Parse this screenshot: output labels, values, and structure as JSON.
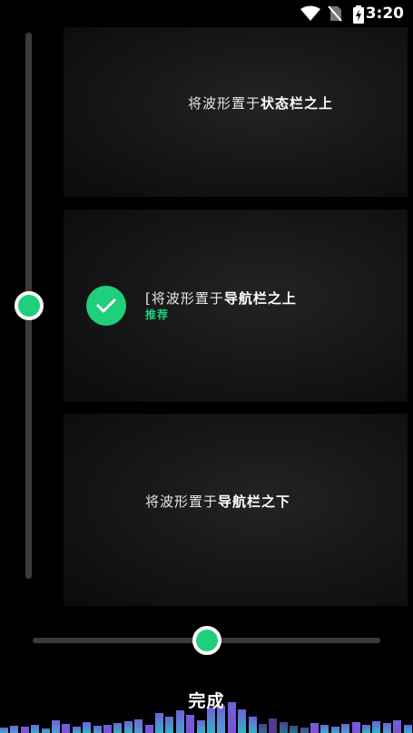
{
  "status_bar": {
    "time": "3:20",
    "icons": [
      "wifi-icon",
      "no-sim-icon",
      "battery-charging-icon"
    ]
  },
  "vertical_slider": {
    "level": 0.5
  },
  "horizontal_slider": {
    "level": 0.5
  },
  "options": [
    {
      "text_plain": "将波形置于",
      "text_bold": "状态栏之上",
      "selected": false
    },
    {
      "prefix": "[",
      "text_plain": "将波形置于",
      "text_bold": "导航栏之上",
      "badge": "推荐",
      "selected": true
    },
    {
      "text_plain": "将波形置于",
      "text_bold": "导航栏之下",
      "selected": false
    }
  ],
  "done_label": "完成",
  "colors": {
    "accent": "#1fcf7c",
    "cyan": "#38c8e0",
    "purple": "#8a5cf0",
    "background": "#000000"
  }
}
